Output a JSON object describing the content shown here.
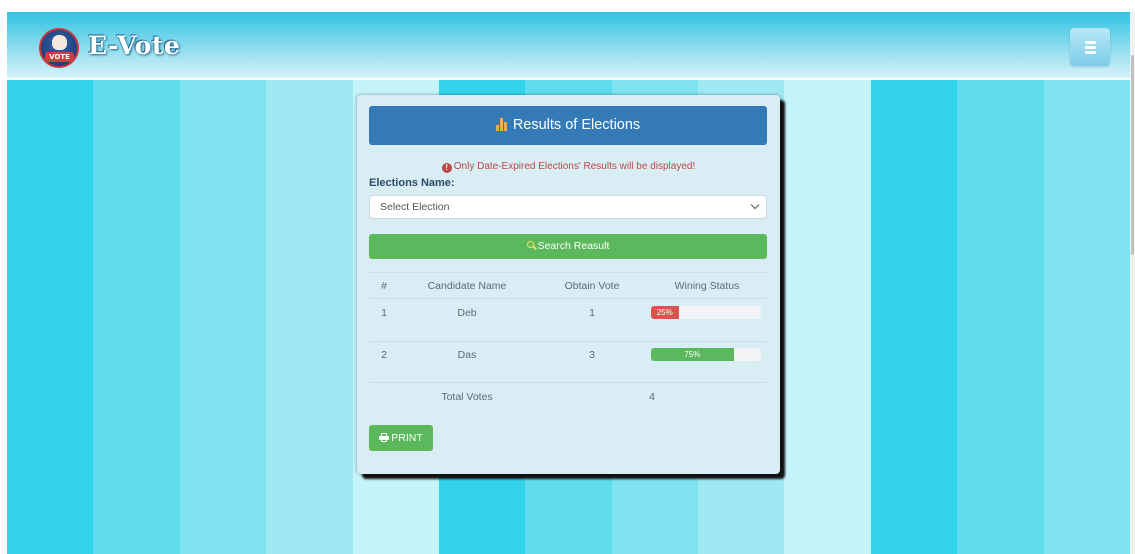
{
  "colors": {
    "stripes": [
      "#33d3ec",
      "#5fdbee",
      "#80e3f2",
      "#9fe9f5",
      "#c5f3fa",
      "#33d3ec",
      "#5fdbee",
      "#80e3f2",
      "#9fe9f5",
      "#c5f3fa",
      "#33d3ec",
      "#5fdbee",
      "#80e3f2"
    ],
    "panel_heading": "#337ab7",
    "success": "#5cb85c",
    "danger": "#d9534f",
    "notice": "#b94a48"
  },
  "header": {
    "brand": "E-Vote",
    "logo_tag": "VOTE",
    "logo_icon": "vote-fist-emblem",
    "menu_icon": "hamburger-icon"
  },
  "panel": {
    "heading": "Results of Elections",
    "heading_icon": "bar-chart-icon",
    "notice": "Only Date-Expired Elections' Results will be displayed!",
    "notice_icon": "info-circle-icon",
    "elections_label": "Elections Name:",
    "select_value": "Select Election",
    "search_label": "Search Reasult",
    "search_icon": "search-icon",
    "print_label": "PRINT",
    "print_icon": "print-icon"
  },
  "table": {
    "headers": [
      "#",
      "Candidate Name",
      "Obtain Vote",
      "Wining Status"
    ],
    "rows": [
      {
        "num": "1",
        "name": "Deb",
        "votes": "1",
        "percent": 25,
        "percent_label": "25%",
        "status": "danger"
      },
      {
        "num": "2",
        "name": "Das",
        "votes": "3",
        "percent": 75,
        "percent_label": "75%",
        "status": "success"
      }
    ],
    "total_label": "Total Votes",
    "total_value": "4"
  }
}
